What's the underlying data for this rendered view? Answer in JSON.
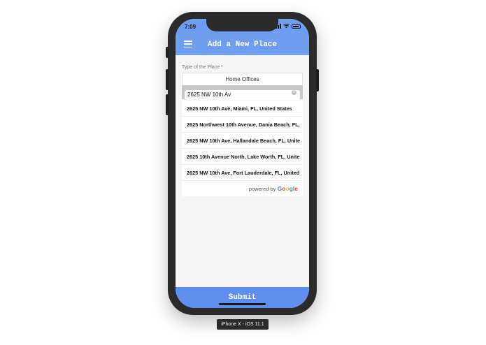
{
  "status_bar": {
    "time": "7:09"
  },
  "header": {
    "title": "Add a New Place"
  },
  "form": {
    "type_label": "Type of the Place *",
    "type_value": "Home Offices",
    "search_value": "2625 NW 10th Av"
  },
  "results": [
    "2625 NW 10th Ave, Miami, FL, United States",
    "2625 Northwest 10th Avenue, Dania Beach, FL,",
    "2625 NW 10th Ave, Hallandale Beach, FL, Unite",
    "2625 10th Avenue North, Lake Worth, FL, Unite",
    "2625 NW 10th Ave, Fort Lauderdale, FL, United"
  ],
  "powered_by": {
    "prefix": "powered by",
    "brand": "Google"
  },
  "submit_label": "Submit",
  "device_label": "iPhone X - iOS 11.1",
  "colors": {
    "header": "#6f9ef0",
    "submit": "#5e8ff0"
  }
}
